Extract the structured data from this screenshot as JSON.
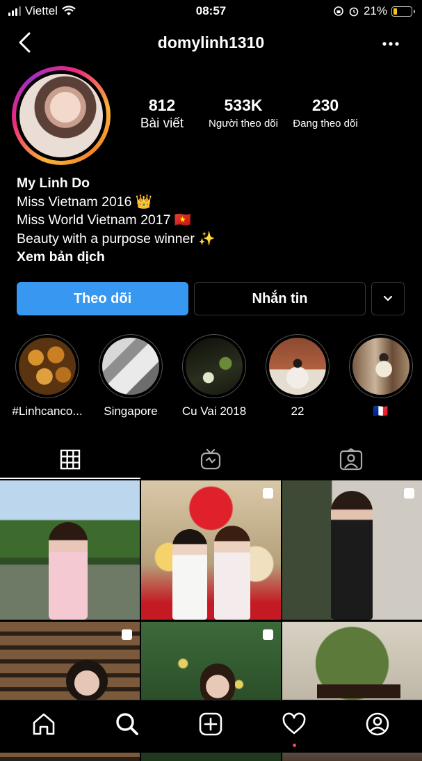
{
  "status_bar": {
    "carrier": "Viettel",
    "time": "08:57",
    "battery": "21%"
  },
  "header": {
    "username": "domylinh1310"
  },
  "stats": [
    {
      "value": "812",
      "label": "Bài viết"
    },
    {
      "value": "533K",
      "label": "Người theo dõi"
    },
    {
      "value": "230",
      "label": "Đang theo dõi"
    }
  ],
  "bio": {
    "name": "My Linh Do",
    "lines": [
      "Miss Vietnam 2016 👑",
      "Miss World Vietnam 2017 🇻🇳",
      "Beauty with a purpose winner ✨"
    ],
    "translate": "Xem bản dịch"
  },
  "buttons": {
    "follow": "Theo dõi",
    "message": "Nhắn tin"
  },
  "highlights": [
    {
      "label": "#Linhcanco..."
    },
    {
      "label": "Singapore"
    },
    {
      "label": "Cu Vai 2018"
    },
    {
      "label": "22"
    },
    {
      "label": "🇫🇷"
    }
  ],
  "tabs": [
    "grid-icon",
    "igtv-icon",
    "tagged-icon"
  ],
  "nav": [
    "home-icon",
    "search-icon",
    "new-post-icon",
    "activity-icon",
    "profile-icon"
  ],
  "colors": {
    "accent": "#3897f0",
    "background": "#000000",
    "notification_dot": "#ed4956"
  }
}
